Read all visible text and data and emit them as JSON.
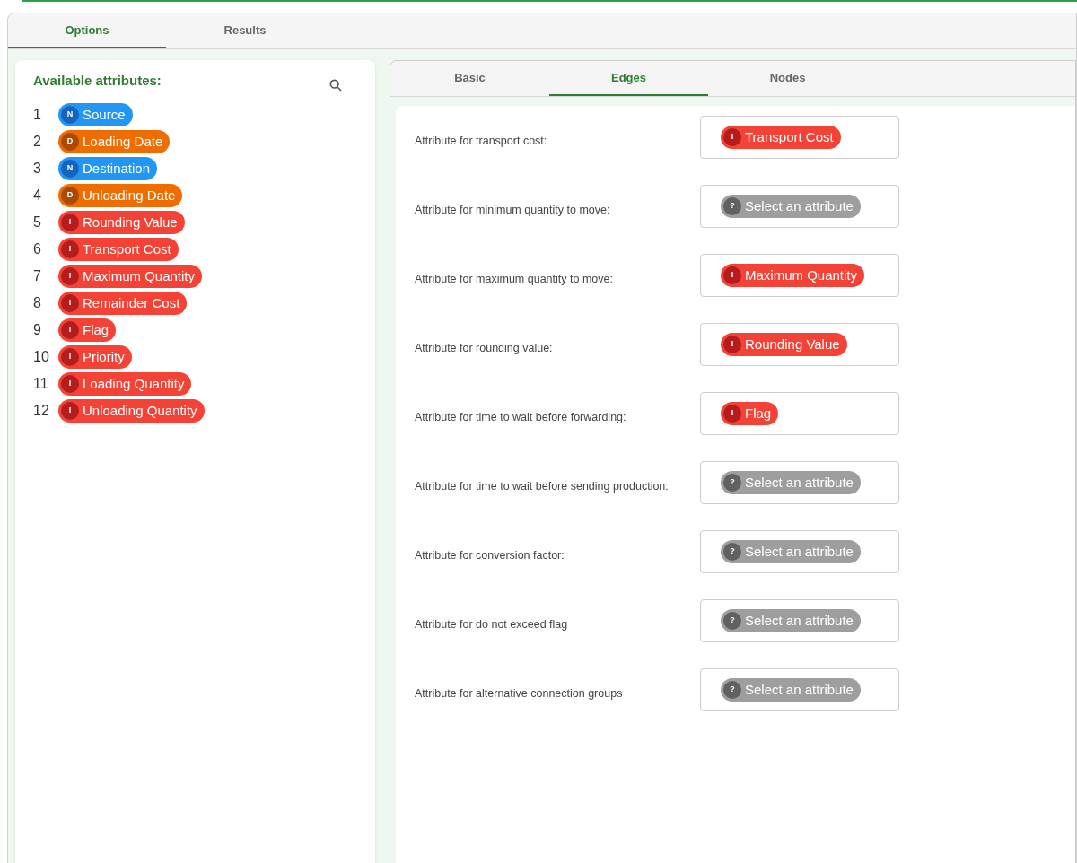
{
  "main_tabs": [
    {
      "label": "Options",
      "selected": true
    },
    {
      "label": "Results",
      "selected": false
    }
  ],
  "attributes_panel": {
    "title": "Available attributes:",
    "items": [
      {
        "number": "1",
        "tag": "N",
        "kind": "node",
        "name": "Source"
      },
      {
        "number": "2",
        "tag": "D",
        "kind": "date",
        "name": "Loading Date"
      },
      {
        "number": "3",
        "tag": "N",
        "kind": "node",
        "name": "Destination"
      },
      {
        "number": "4",
        "tag": "D",
        "kind": "date",
        "name": "Unloading Date"
      },
      {
        "number": "5",
        "tag": "I",
        "kind": "integer",
        "name": "Rounding Value"
      },
      {
        "number": "6",
        "tag": "I",
        "kind": "integer",
        "name": "Transport Cost"
      },
      {
        "number": "7",
        "tag": "I",
        "kind": "integer",
        "name": "Maximum Quantity"
      },
      {
        "number": "8",
        "tag": "I",
        "kind": "integer",
        "name": "Remainder Cost"
      },
      {
        "number": "9",
        "tag": "I",
        "kind": "integer",
        "name": "Flag"
      },
      {
        "number": "10",
        "tag": "I",
        "kind": "integer",
        "name": "Priority"
      },
      {
        "number": "11",
        "tag": "I",
        "kind": "integer",
        "name": "Loading Quantity"
      },
      {
        "number": "12",
        "tag": "I",
        "kind": "integer",
        "name": "Unloading Quantity"
      }
    ]
  },
  "settings_tabs": [
    {
      "label": "Basic",
      "selected": false
    },
    {
      "label": "Edges",
      "selected": true
    },
    {
      "label": "Nodes",
      "selected": false
    }
  ],
  "settings": [
    {
      "label": "Attribute for transport cost:",
      "tag": "I",
      "kind": "integer",
      "value": "Transport Cost"
    },
    {
      "label": "Attribute for minimum quantity to move:",
      "tag": "?",
      "kind": "empty",
      "value": "Select an attribute"
    },
    {
      "label": "Attribute for maximum quantity to move:",
      "tag": "I",
      "kind": "integer",
      "value": "Maximum Quantity"
    },
    {
      "label": "Attribute for rounding value:",
      "tag": "I",
      "kind": "integer",
      "value": "Rounding Value"
    },
    {
      "label": "Attribute for time to wait before forwarding:",
      "tag": "I",
      "kind": "integer",
      "value": "Flag"
    },
    {
      "label": "Attribute for time to wait before sending production:",
      "tag": "?",
      "kind": "empty",
      "value": "Select an attribute"
    },
    {
      "label": "Attribute for conversion factor:",
      "tag": "?",
      "kind": "empty",
      "value": "Select an attribute"
    },
    {
      "label": "Attribute for do not exceed flag",
      "tag": "?",
      "kind": "empty",
      "value": "Select an attribute"
    },
    {
      "label": "Attribute for alternative connection groups",
      "tag": "?",
      "kind": "empty",
      "value": "Select an attribute"
    }
  ]
}
